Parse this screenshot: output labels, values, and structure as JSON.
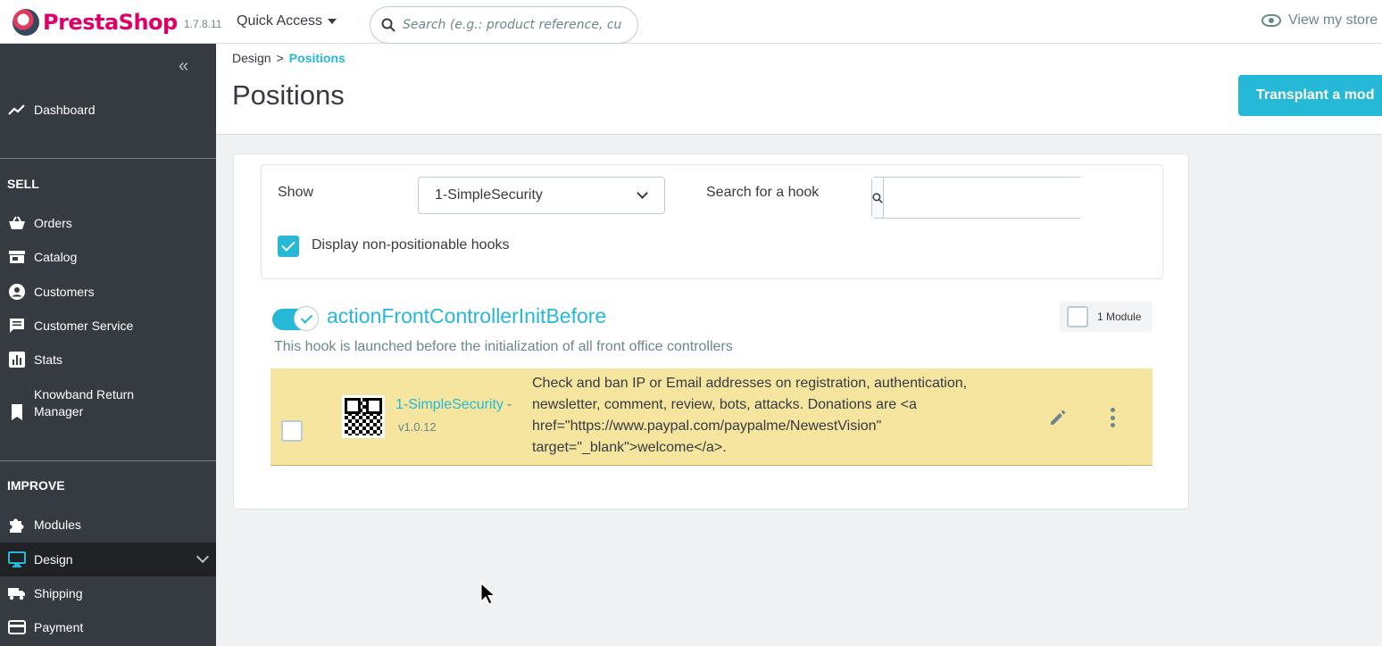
{
  "header": {
    "brand": "PrestaShop",
    "version": "1.7.8.11",
    "quick_access": "Quick Access",
    "search_placeholder": "Search (e.g.: product reference, custon",
    "view_store": "View my store"
  },
  "sidebar": {
    "dashboard": "Dashboard",
    "sell_title": "SELL",
    "orders": "Orders",
    "catalog": "Catalog",
    "customers": "Customers",
    "customer_service": "Customer Service",
    "stats": "Stats",
    "knowband_line1": "Knowband Return",
    "knowband_line2": "Manager",
    "improve_title": "IMPROVE",
    "modules": "Modules",
    "design": "Design",
    "shipping": "Shipping",
    "payment": "Payment"
  },
  "page": {
    "breadcrumb_parent": "Design",
    "breadcrumb_sep": ">",
    "breadcrumb_current": "Positions",
    "title": "Positions",
    "transplant_button": "Transplant a mod"
  },
  "filters": {
    "show_label": "Show",
    "show_value": "1-SimpleSecurity",
    "search_label": "Search for a hook",
    "search_value": "",
    "non_positionable_label": "Display non-positionable hooks",
    "non_positionable_checked": true
  },
  "hook": {
    "name": "actionFrontControllerInitBefore",
    "description": "This hook is launched before the initialization of all front office controllers",
    "module_count": "1 Module",
    "enabled": true
  },
  "module": {
    "name": "1-SimpleSecurity",
    "dash": "-",
    "version": "v1.0.12",
    "description": "Check and ban IP or Email addresses on registration, authentication, newsletter, comment, review, bots, attacks. Donations are <a href=\"https://www.paypal.com/paypalme/NewestVision\" target=\"_blank\">welcome</a>."
  },
  "colors": {
    "accent": "#25b9d7",
    "sidebar_bg": "#363a41",
    "row_highlight": "#f5e59e"
  }
}
